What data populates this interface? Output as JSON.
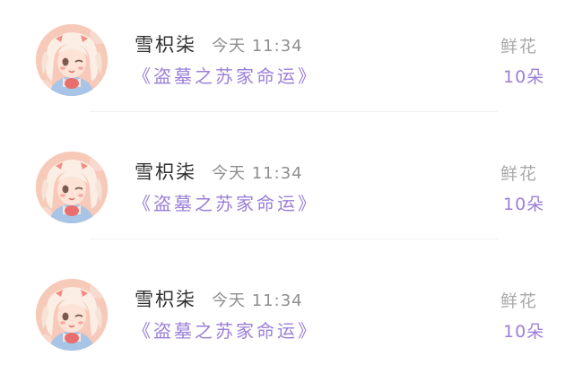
{
  "list": {
    "items": [
      {
        "user_name": "雪枳柒",
        "time": "今天 11:34",
        "title": "《盗墓之苏家命运》",
        "gift_name": "鲜花",
        "gift_count": "10朵"
      },
      {
        "user_name": "雪枳柒",
        "time": "今天 11:34",
        "title": "《盗墓之苏家命运》",
        "gift_name": "鲜花",
        "gift_count": "10朵"
      },
      {
        "user_name": "雪枳柒",
        "time": "今天 11:34",
        "title": "《盗墓之苏家命运》",
        "gift_name": "鲜花",
        "gift_count": "10朵"
      }
    ]
  },
  "colors": {
    "accent_purple": "#9b7fd8",
    "name_text": "#2f2f2f",
    "muted_text": "#8e8e8e",
    "avatar_background": "#f7c9b8"
  },
  "icons": {
    "avatar": "anime-girl-avatar-icon"
  }
}
